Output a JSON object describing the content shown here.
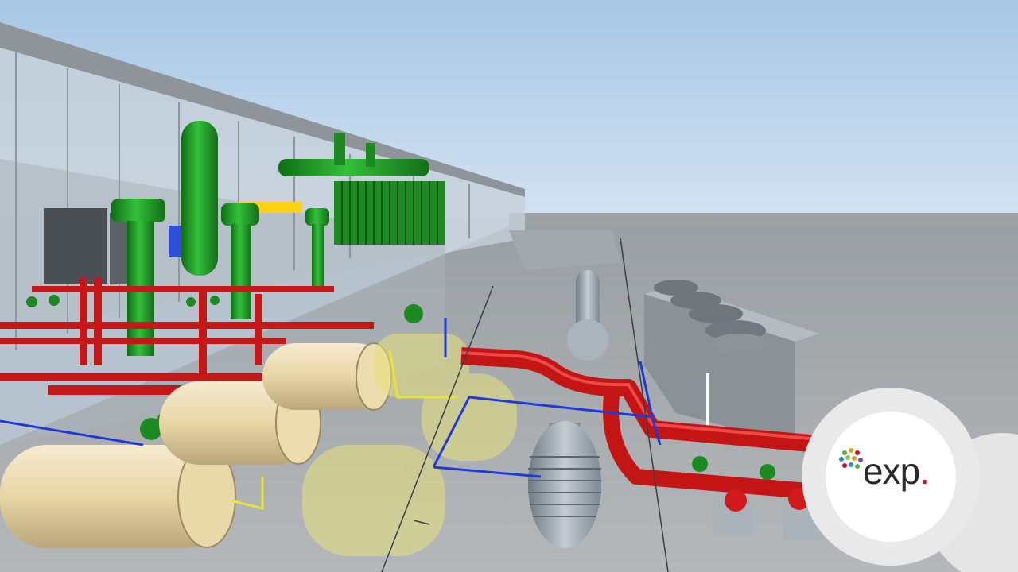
{
  "scene": {
    "title": "",
    "description_hidden": false
  },
  "logo": {
    "text": "exp",
    "dot": ".",
    "accent_color": "#c8102e",
    "text_color": "#2b2b2b",
    "icon": "exp-dots-logo-icon"
  },
  "colors": {
    "sky": "#b9d3ec",
    "floor": "#9ea3a6",
    "pipe_red": "#d11a1a",
    "pipe_green": "#1e9b22",
    "pipe_blue": "#1e3ad6",
    "pipe_yellow": "#e8e23a",
    "tank_beige": "#e9d8a8",
    "equipment_gray": "#8e959b"
  }
}
